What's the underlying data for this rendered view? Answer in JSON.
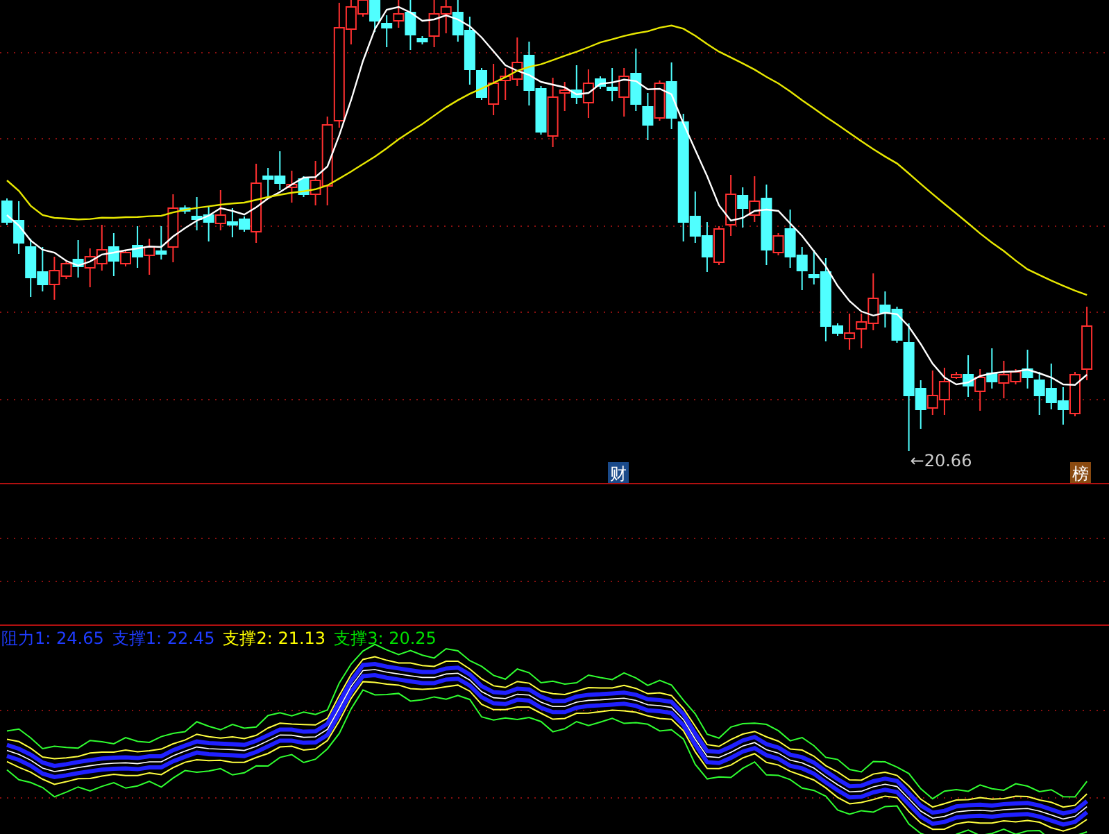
{
  "main_chart": {
    "low_marker": "←20.66",
    "badges": [
      {
        "text": "财",
        "color": "#1a4a8a"
      },
      {
        "text": "榜",
        "color": "#8a4a10"
      }
    ]
  },
  "indicator": {
    "legend": [
      {
        "text": "阻力1: 24.65",
        "color": "#1f3cff"
      },
      {
        "text": "支撑1: 22.45",
        "color": "#1f3cff"
      },
      {
        "text": "支撑2: 21.13",
        "color": "#ffff00"
      },
      {
        "text": "支撑3: 20.25",
        "color": "#00e000"
      }
    ]
  }
}
